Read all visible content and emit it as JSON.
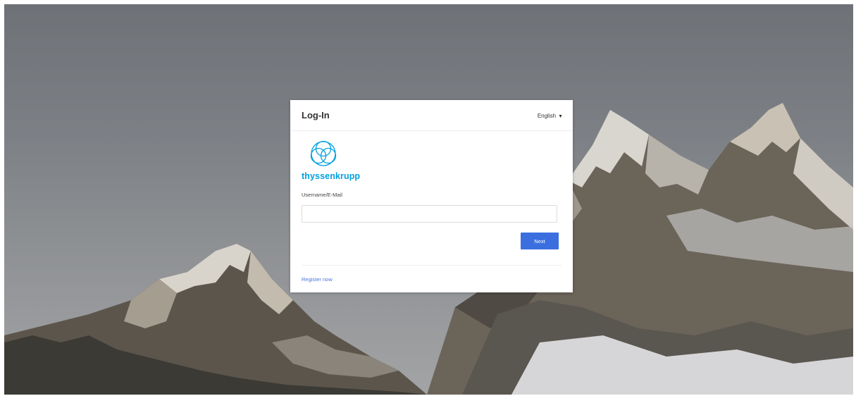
{
  "login": {
    "title": "Log-In",
    "language": "English",
    "brand": "thyssenkrupp",
    "username_label": "Username/E-Mail",
    "username_value": "",
    "username_placeholder": "",
    "next_label": "Next",
    "register_label": "Register now"
  },
  "icons": {
    "language_caret": "caret-down-icon",
    "brand_logo": "thyssenkrupp-logo-icon"
  },
  "colors": {
    "primary_button": "#3b6fe0",
    "brand": "#00a0e1",
    "link": "#4a78d8"
  }
}
